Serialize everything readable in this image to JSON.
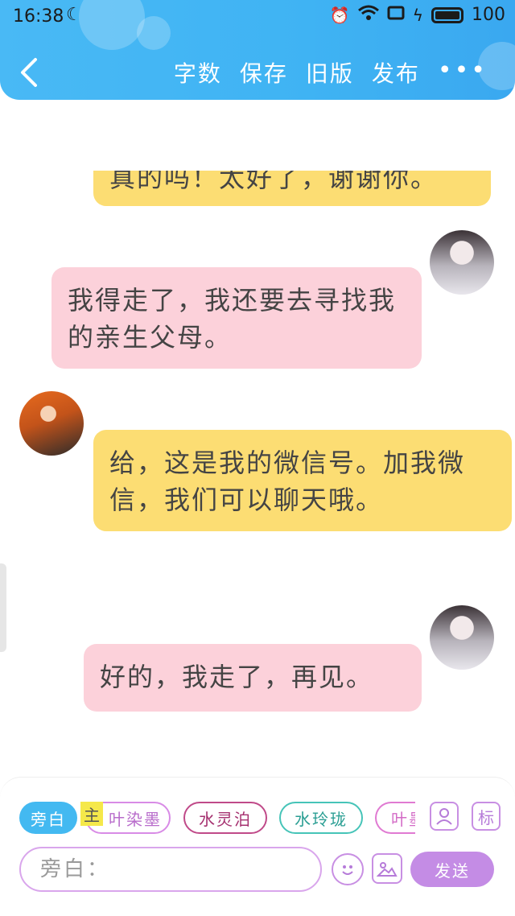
{
  "status_bar": {
    "time": "16:38",
    "battery": "100"
  },
  "header": {
    "nav": {
      "word_count": "字数",
      "save": "保存",
      "old_version": "旧版",
      "publish": "发布",
      "more": "•••"
    }
  },
  "messages": [
    {
      "text": "真的吗！太好了，谢谢你。"
    },
    {
      "text": "我得走了，我还要去寻找我的亲生父母。"
    },
    {
      "text": "给，这是我的微信号。加我微信，我们可以聊天哦。"
    },
    {
      "text": "好的，我走了，再见。"
    }
  ],
  "characters": {
    "narration": "旁白",
    "main_tag": "主",
    "c1": "叶染墨",
    "c2": "水灵泊",
    "c3": "水玲珑",
    "c4": "叶墨"
  },
  "toolbar": {
    "mark": "标",
    "input_placeholder": "旁白：",
    "send": "发送"
  },
  "colors": {
    "header": "#49b9f5",
    "yellow_bubble": "#fcdd73",
    "pink_bubble": "#fcd1da",
    "send": "#c48ce5"
  }
}
